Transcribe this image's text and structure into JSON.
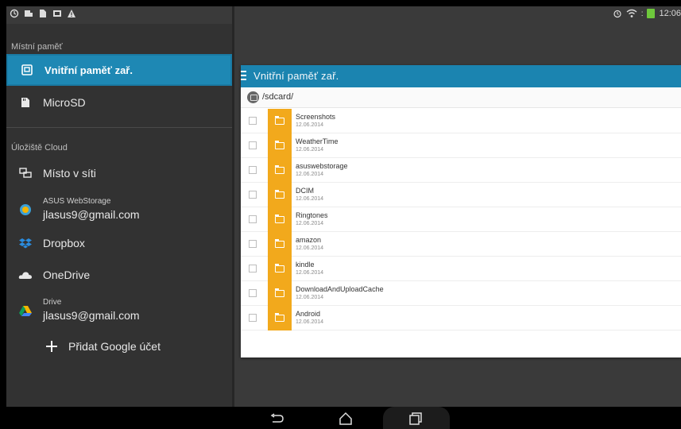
{
  "status_bar": {
    "time": "12:06"
  },
  "sidebar": {
    "local_header": "Místní paměť",
    "cloud_header": "Úložiště Cloud",
    "items": [
      {
        "label": "Vnitřní paměť zař.",
        "icon": "internal-storage-icon",
        "active": true
      },
      {
        "label": "MicroSD",
        "icon": "sd-card-icon",
        "active": false
      }
    ],
    "cloud_items": [
      {
        "label": "Místo v síti",
        "icon": "network-place-icon"
      },
      {
        "title": "ASUS WebStorage",
        "account": "jlasus9@gmail.com",
        "icon": "asus-webstorage-icon"
      },
      {
        "label": "Dropbox",
        "icon": "dropbox-icon"
      },
      {
        "label": "OneDrive",
        "icon": "onedrive-icon"
      },
      {
        "title": "Drive",
        "account": "jlasus9@gmail.com",
        "icon": "google-drive-icon"
      }
    ],
    "add_account_label": "Přidat Google účet"
  },
  "panel": {
    "title": "Vnitřní paměť zař.",
    "path": "/sdcard/",
    "files": [
      {
        "name": "Screenshots",
        "date": "12.06.2014"
      },
      {
        "name": "WeatherTime",
        "date": "12.06.2014"
      },
      {
        "name": "asuswebstorage",
        "date": "12.06.2014"
      },
      {
        "name": "DCIM",
        "date": "12.06.2014"
      },
      {
        "name": "Ringtones",
        "date": "12.06.2014"
      },
      {
        "name": "amazon",
        "date": "12.06.2014"
      },
      {
        "name": "kindle",
        "date": "12.06.2014"
      },
      {
        "name": "DownloadAndUploadCache",
        "date": "12.06.2014"
      },
      {
        "name": "Android",
        "date": "12.06.2014"
      }
    ]
  },
  "colors": {
    "accent": "#1e88b4",
    "folder": "#f2a91c",
    "sidebar_bg": "#323232",
    "battery": "#6ec83c"
  }
}
